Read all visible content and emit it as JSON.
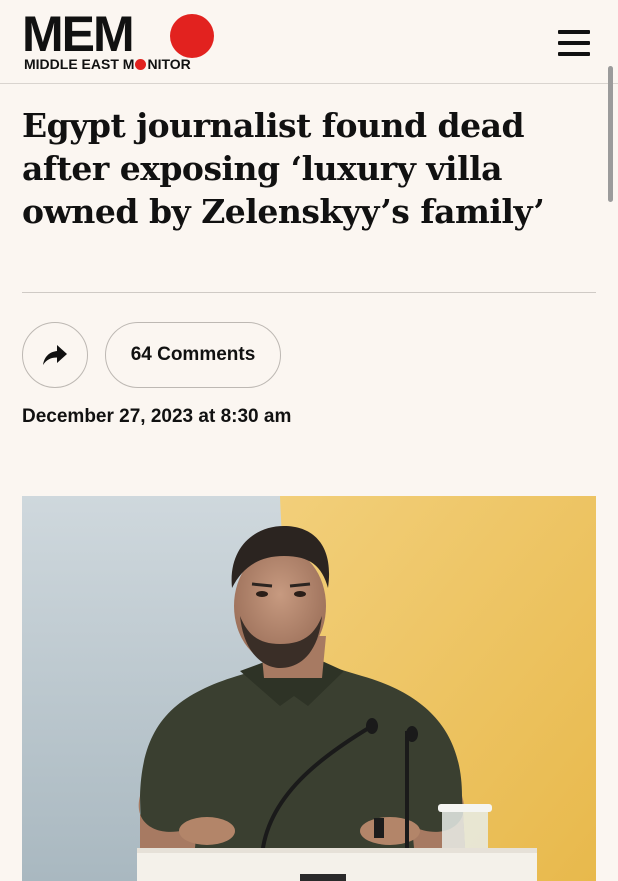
{
  "header": {
    "logo_word": "MEM",
    "logo_sub_before": "MIDDLE EAST M",
    "logo_sub_after": "NITOR",
    "menu_icon": "hamburger-menu-icon",
    "brand_color": "#e2221f"
  },
  "article": {
    "title": "Egypt journalist found dead after exposing ‘luxury villa owned by Zelenskyy’s family’",
    "share_icon": "share-arrow-icon",
    "comments_label": "64 Comments",
    "date": "December 27, 2023 at 8:30 am"
  }
}
